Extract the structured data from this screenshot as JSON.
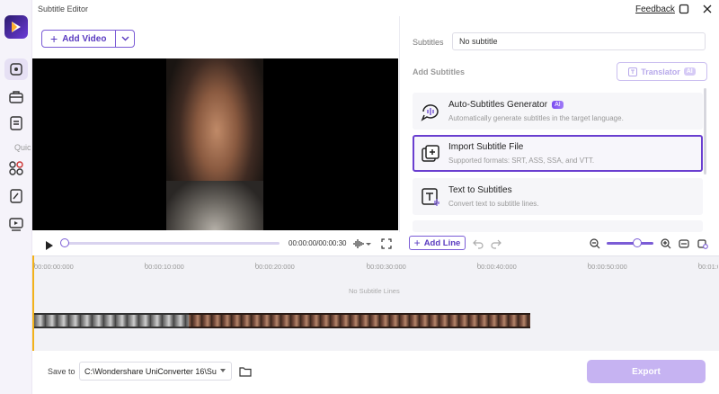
{
  "window": {
    "title": "Subtitle Editor",
    "feedback_label": "Feedback"
  },
  "sidebar": {
    "quick_label": "Quic"
  },
  "toolbar": {
    "add_video_label": "Add Video"
  },
  "player": {
    "timecode": "00:00:00/00:00:30"
  },
  "panel": {
    "subtitles_label": "Subtitles",
    "subtitles_value": "No subtitle",
    "add_subtitles_label": "Add Subtitles",
    "translator_label": "Translator",
    "translator_badge": "AI",
    "cards": [
      {
        "title": "Auto-Subtitles Generator",
        "badge": "AI",
        "desc": "Automatically generate subtitles in the target language."
      },
      {
        "title": "Import Subtitle File",
        "desc": "Supported formats: SRT, ASS, SSA, and VTT."
      },
      {
        "title": "Text to Subtitles",
        "desc": "Convert text to subtitle lines."
      }
    ]
  },
  "timeline": {
    "add_line_label": "Add Line",
    "ruler": [
      "00:00:00:000",
      "00:00:10:000",
      "00:00:20:000",
      "00:00:30:000",
      "00:00:40:000",
      "00:00:50:000",
      "00:01:0"
    ],
    "empty_text": "No Subtitle Lines"
  },
  "footer": {
    "save_to_label": "Save to",
    "save_path": "C:\\Wondershare UniConverter 16\\Su",
    "export_label": "Export"
  },
  "colors": {
    "accent": "#6a3fd0",
    "export_disabled": "#c6b3f2",
    "playhead": "#f2b21a"
  }
}
